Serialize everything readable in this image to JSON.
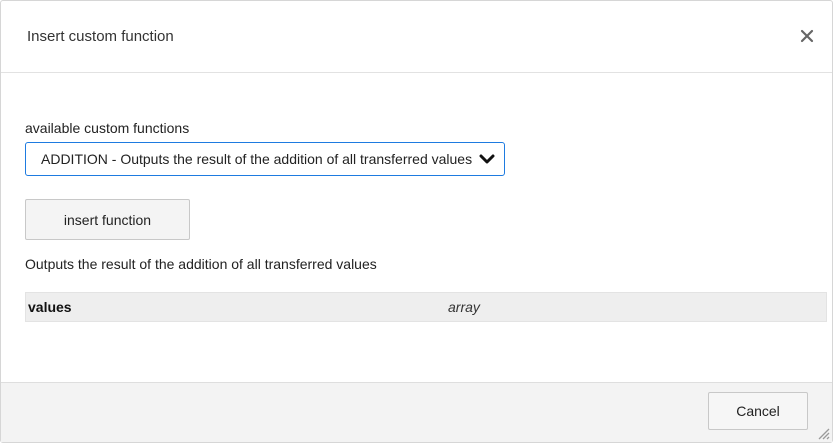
{
  "dialog": {
    "title": "Insert custom function",
    "close_icon": "close-icon"
  },
  "function_select": {
    "label": "available custom functions",
    "selected": "ADDITION - Outputs the result of the addition of all transferred values",
    "chevron_icon": "chevron-down-icon",
    "accent": "#1e7be0"
  },
  "insert_button": {
    "label": "insert function"
  },
  "description": "Outputs the result of the addition of all transferred values",
  "parameters": [
    {
      "name": "values",
      "type": "array"
    }
  ],
  "footer": {
    "cancel_label": "Cancel",
    "resize_icon": "resize-grip-icon"
  }
}
